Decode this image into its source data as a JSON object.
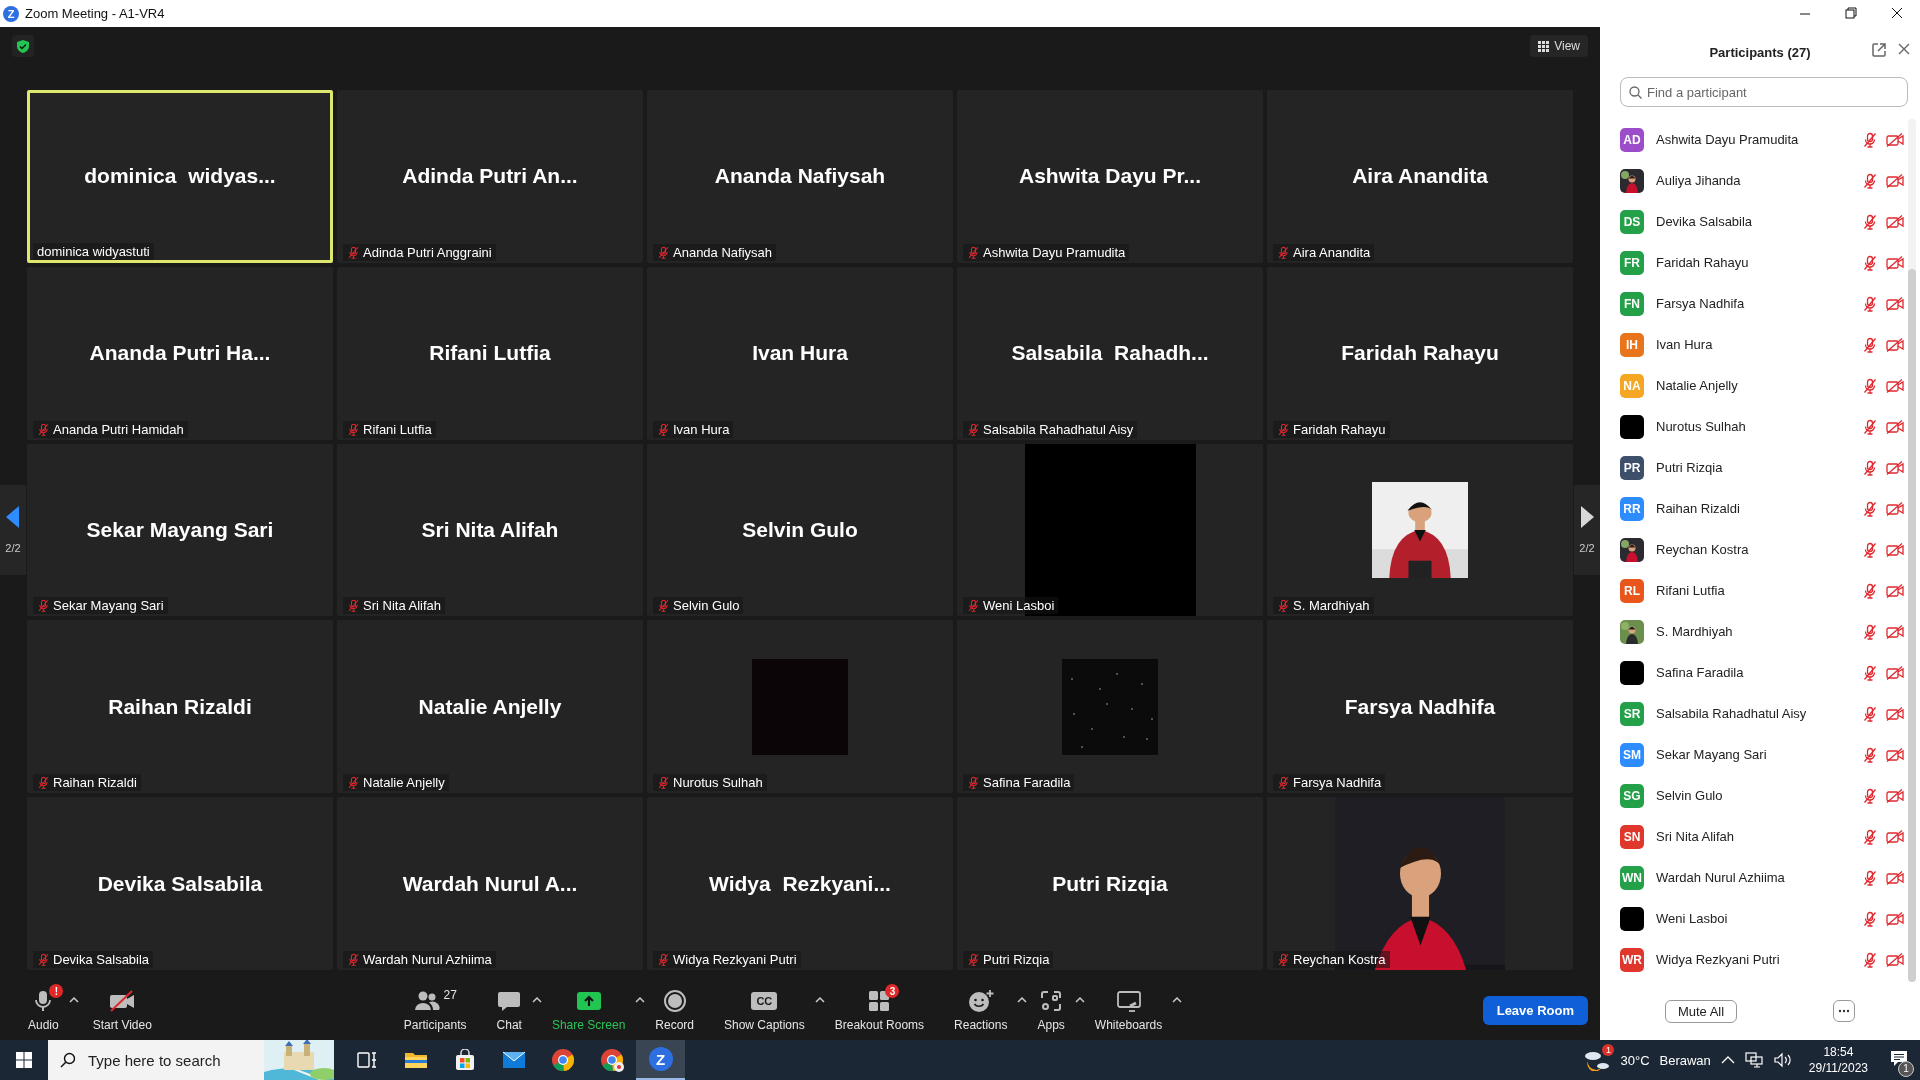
{
  "window": {
    "logo": "Z",
    "title": "Zoom Meeting - A1-VR4"
  },
  "view_button": {
    "label": "View"
  },
  "pager": {
    "previous": "2/2",
    "next": "2/2"
  },
  "tiles": [
    {
      "display_name": "dominica  widyas...",
      "label": "dominica widyastuti",
      "muted": false,
      "active_speaker": true,
      "kind": "name"
    },
    {
      "display_name": "Adinda Putri An...",
      "label": "Adinda Putri Anggraini",
      "muted": true,
      "active_speaker": false,
      "kind": "name"
    },
    {
      "display_name": "Ananda Nafiysah",
      "label": "Ananda Nafiysah",
      "muted": true,
      "active_speaker": false,
      "kind": "name"
    },
    {
      "display_name": "Ashwita Dayu Pr...",
      "label": "Ashwita Dayu Pramudita",
      "muted": true,
      "active_speaker": false,
      "kind": "name"
    },
    {
      "display_name": "Aira Anandita",
      "label": "Aira Anandita",
      "muted": true,
      "active_speaker": false,
      "kind": "name"
    },
    {
      "display_name": "Ananda Putri Ha...",
      "label": "Ananda Putri Hamidah",
      "muted": true,
      "active_speaker": false,
      "kind": "name"
    },
    {
      "display_name": "Rifani Lutfia",
      "label": "Rifani Lutfia",
      "muted": true,
      "active_speaker": false,
      "kind": "name"
    },
    {
      "display_name": "Ivan Hura",
      "label": "Ivan Hura",
      "muted": true,
      "active_speaker": false,
      "kind": "name"
    },
    {
      "display_name": "Salsabila  Rahadh...",
      "label": "Salsabila Rahadhatul Aisy",
      "muted": true,
      "active_speaker": false,
      "kind": "name"
    },
    {
      "display_name": "Faridah Rahayu",
      "label": "Faridah Rahayu",
      "muted": true,
      "active_speaker": false,
      "kind": "name"
    },
    {
      "display_name": "Sekar Mayang Sari",
      "label": "Sekar Mayang Sari",
      "muted": true,
      "active_speaker": false,
      "kind": "name"
    },
    {
      "display_name": "Sri Nita Alifah",
      "label": "Sri Nita Alifah",
      "muted": true,
      "active_speaker": false,
      "kind": "name"
    },
    {
      "display_name": "Selvin Gulo",
      "label": "Selvin Gulo",
      "muted": true,
      "active_speaker": false,
      "kind": "name"
    },
    {
      "label": "Weni Lasboi",
      "muted": true,
      "active_speaker": false,
      "kind": "blank-tall"
    },
    {
      "label": "S. Mardhiyah",
      "muted": true,
      "active_speaker": false,
      "kind": "picture-small"
    },
    {
      "display_name": "Raihan Rizaldi",
      "label": "Raihan Rizaldi",
      "muted": true,
      "active_speaker": false,
      "kind": "name"
    },
    {
      "display_name": "Natalie Anjelly",
      "label": "Natalie Anjelly",
      "muted": true,
      "active_speaker": false,
      "kind": "name"
    },
    {
      "label": "Nurotus Sulhah",
      "muted": true,
      "active_speaker": false,
      "kind": "blank-small"
    },
    {
      "label": "Safina Faradila",
      "muted": true,
      "active_speaker": false,
      "kind": "noise-small"
    },
    {
      "display_name": "Farsya Nadhifa",
      "label": "Farsya Nadhifa",
      "muted": true,
      "active_speaker": false,
      "kind": "name"
    },
    {
      "display_name": "Devika Salsabila",
      "label": "Devika Salsabila",
      "muted": true,
      "active_speaker": false,
      "kind": "name"
    },
    {
      "display_name": "Wardah Nurul A...",
      "label": "Wardah Nurul Azhiima",
      "muted": true,
      "active_speaker": false,
      "kind": "name"
    },
    {
      "display_name": "Widya  Rezkyani...",
      "label": "Widya Rezkyani Putri",
      "muted": true,
      "active_speaker": false,
      "kind": "name"
    },
    {
      "display_name": "Putri Rizqia",
      "label": "Putri Rizqia",
      "muted": true,
      "active_speaker": false,
      "kind": "name"
    },
    {
      "label": "Reychan Kostra",
      "muted": true,
      "active_speaker": false,
      "kind": "picture-tall"
    }
  ],
  "toolbar": [
    {
      "kind": "audio",
      "label": "Audio",
      "badge": "!",
      "caret": true
    },
    {
      "kind": "video",
      "label": "Start Video",
      "caret": false
    },
    {
      "kind": "participants",
      "label": "Participants",
      "count": "27",
      "caret": false
    },
    {
      "kind": "chat",
      "label": "Chat",
      "caret": true
    },
    {
      "kind": "share",
      "label": "Share Screen",
      "caret": true
    },
    {
      "kind": "record",
      "label": "Record",
      "caret": false
    },
    {
      "kind": "captions",
      "label": "Show Captions",
      "icon_text": "CC",
      "caret": true
    },
    {
      "kind": "breakout",
      "label": "Breakout Rooms",
      "badge": "3",
      "caret": false
    },
    {
      "kind": "reactions",
      "label": "Reactions",
      "caret": true
    },
    {
      "kind": "apps",
      "label": "Apps",
      "caret": true
    },
    {
      "kind": "whiteboards",
      "label": "Whiteboards",
      "caret": true
    }
  ],
  "leave_button": "Leave Room",
  "participants_panel": {
    "title": "Participants (27)",
    "search": {
      "placeholder": "Find a participant"
    },
    "participants": [
      {
        "name": "Ashwita Dayu Pramudita",
        "kind": "initials",
        "initials": "AD",
        "color": "#9b4dca",
        "muted": true,
        "video_off": true
      },
      {
        "name": "Auliya Jihanda",
        "kind": "picture",
        "muted": true,
        "video_off": true
      },
      {
        "name": "Devika Salsabila",
        "kind": "initials",
        "initials": "DS",
        "color": "#24a148",
        "muted": true,
        "video_off": true
      },
      {
        "name": "Faridah Rahayu",
        "kind": "initials",
        "initials": "FR",
        "color": "#24a148",
        "muted": true,
        "video_off": true
      },
      {
        "name": "Farsya Nadhifa",
        "kind": "initials",
        "initials": "FN",
        "color": "#24a148",
        "muted": true,
        "video_off": true
      },
      {
        "name": "Ivan Hura",
        "kind": "initials",
        "initials": "IH",
        "color": "#e8741c",
        "muted": true,
        "video_off": true
      },
      {
        "name": "Natalie Anjelly",
        "kind": "initials",
        "initials": "NA",
        "color": "#f5a623",
        "muted": true,
        "video_off": true
      },
      {
        "name": "Nurotus Sulhah",
        "kind": "blank",
        "muted": true,
        "video_off": true
      },
      {
        "name": "Putri Rizqia",
        "kind": "initials",
        "initials": "PR",
        "color": "#3d4f6b",
        "muted": true,
        "video_off": true
      },
      {
        "name": "Raihan Rizaldi",
        "kind": "initials",
        "initials": "RR",
        "color": "#2d8cff",
        "muted": true,
        "video_off": true
      },
      {
        "name": "Reychan Kostra",
        "kind": "picture",
        "muted": true,
        "video_off": true
      },
      {
        "name": "Rifani Lutfia",
        "kind": "initials",
        "initials": "RL",
        "color": "#e8561c",
        "muted": true,
        "video_off": true
      },
      {
        "name": "S. Mardhiyah",
        "kind": "picture",
        "muted": true,
        "video_off": true
      },
      {
        "name": "Safina Faradila",
        "kind": "blank",
        "muted": true,
        "video_off": true
      },
      {
        "name": "Salsabila Rahadhatul Aisy",
        "kind": "initials",
        "initials": "SR",
        "color": "#24a148",
        "muted": true,
        "video_off": true
      },
      {
        "name": "Sekar Mayang Sari",
        "kind": "initials",
        "initials": "SM",
        "color": "#2d8cff",
        "muted": true,
        "video_off": true
      },
      {
        "name": "Selvin Gulo",
        "kind": "initials",
        "initials": "SG",
        "color": "#24a148",
        "muted": true,
        "video_off": true
      },
      {
        "name": "Sri Nita Alifah",
        "kind": "initials",
        "initials": "SN",
        "color": "#e0372c",
        "muted": true,
        "video_off": true
      },
      {
        "name": "Wardah Nurul Azhiima",
        "kind": "initials",
        "initials": "WN",
        "color": "#24a148",
        "muted": true,
        "video_off": true
      },
      {
        "name": "Weni Lasboi",
        "kind": "blank",
        "muted": true,
        "video_off": true
      },
      {
        "name": "Widya Rezkyani Putri",
        "kind": "initials",
        "initials": "WR",
        "color": "#e0372c",
        "muted": true,
        "video_off": true
      }
    ],
    "mute_all": "Mute All"
  },
  "taskbar": {
    "search": {
      "placeholder": "Type here to search"
    },
    "apps": [
      {
        "kind": "task-view",
        "active": false
      },
      {
        "kind": "folder",
        "active": false
      },
      {
        "kind": "store",
        "active": false
      },
      {
        "kind": "mail",
        "active": false
      },
      {
        "kind": "browser",
        "active": false
      },
      {
        "kind": "browser-profile",
        "active": false
      },
      {
        "kind": "zoom",
        "glyph": "Z",
        "active": true
      }
    ],
    "weather": {
      "badge": "1",
      "temperature": "30°C",
      "condition": "Berawan"
    },
    "time": "18:54",
    "date": "29/11/2023",
    "notifications": "1"
  }
}
